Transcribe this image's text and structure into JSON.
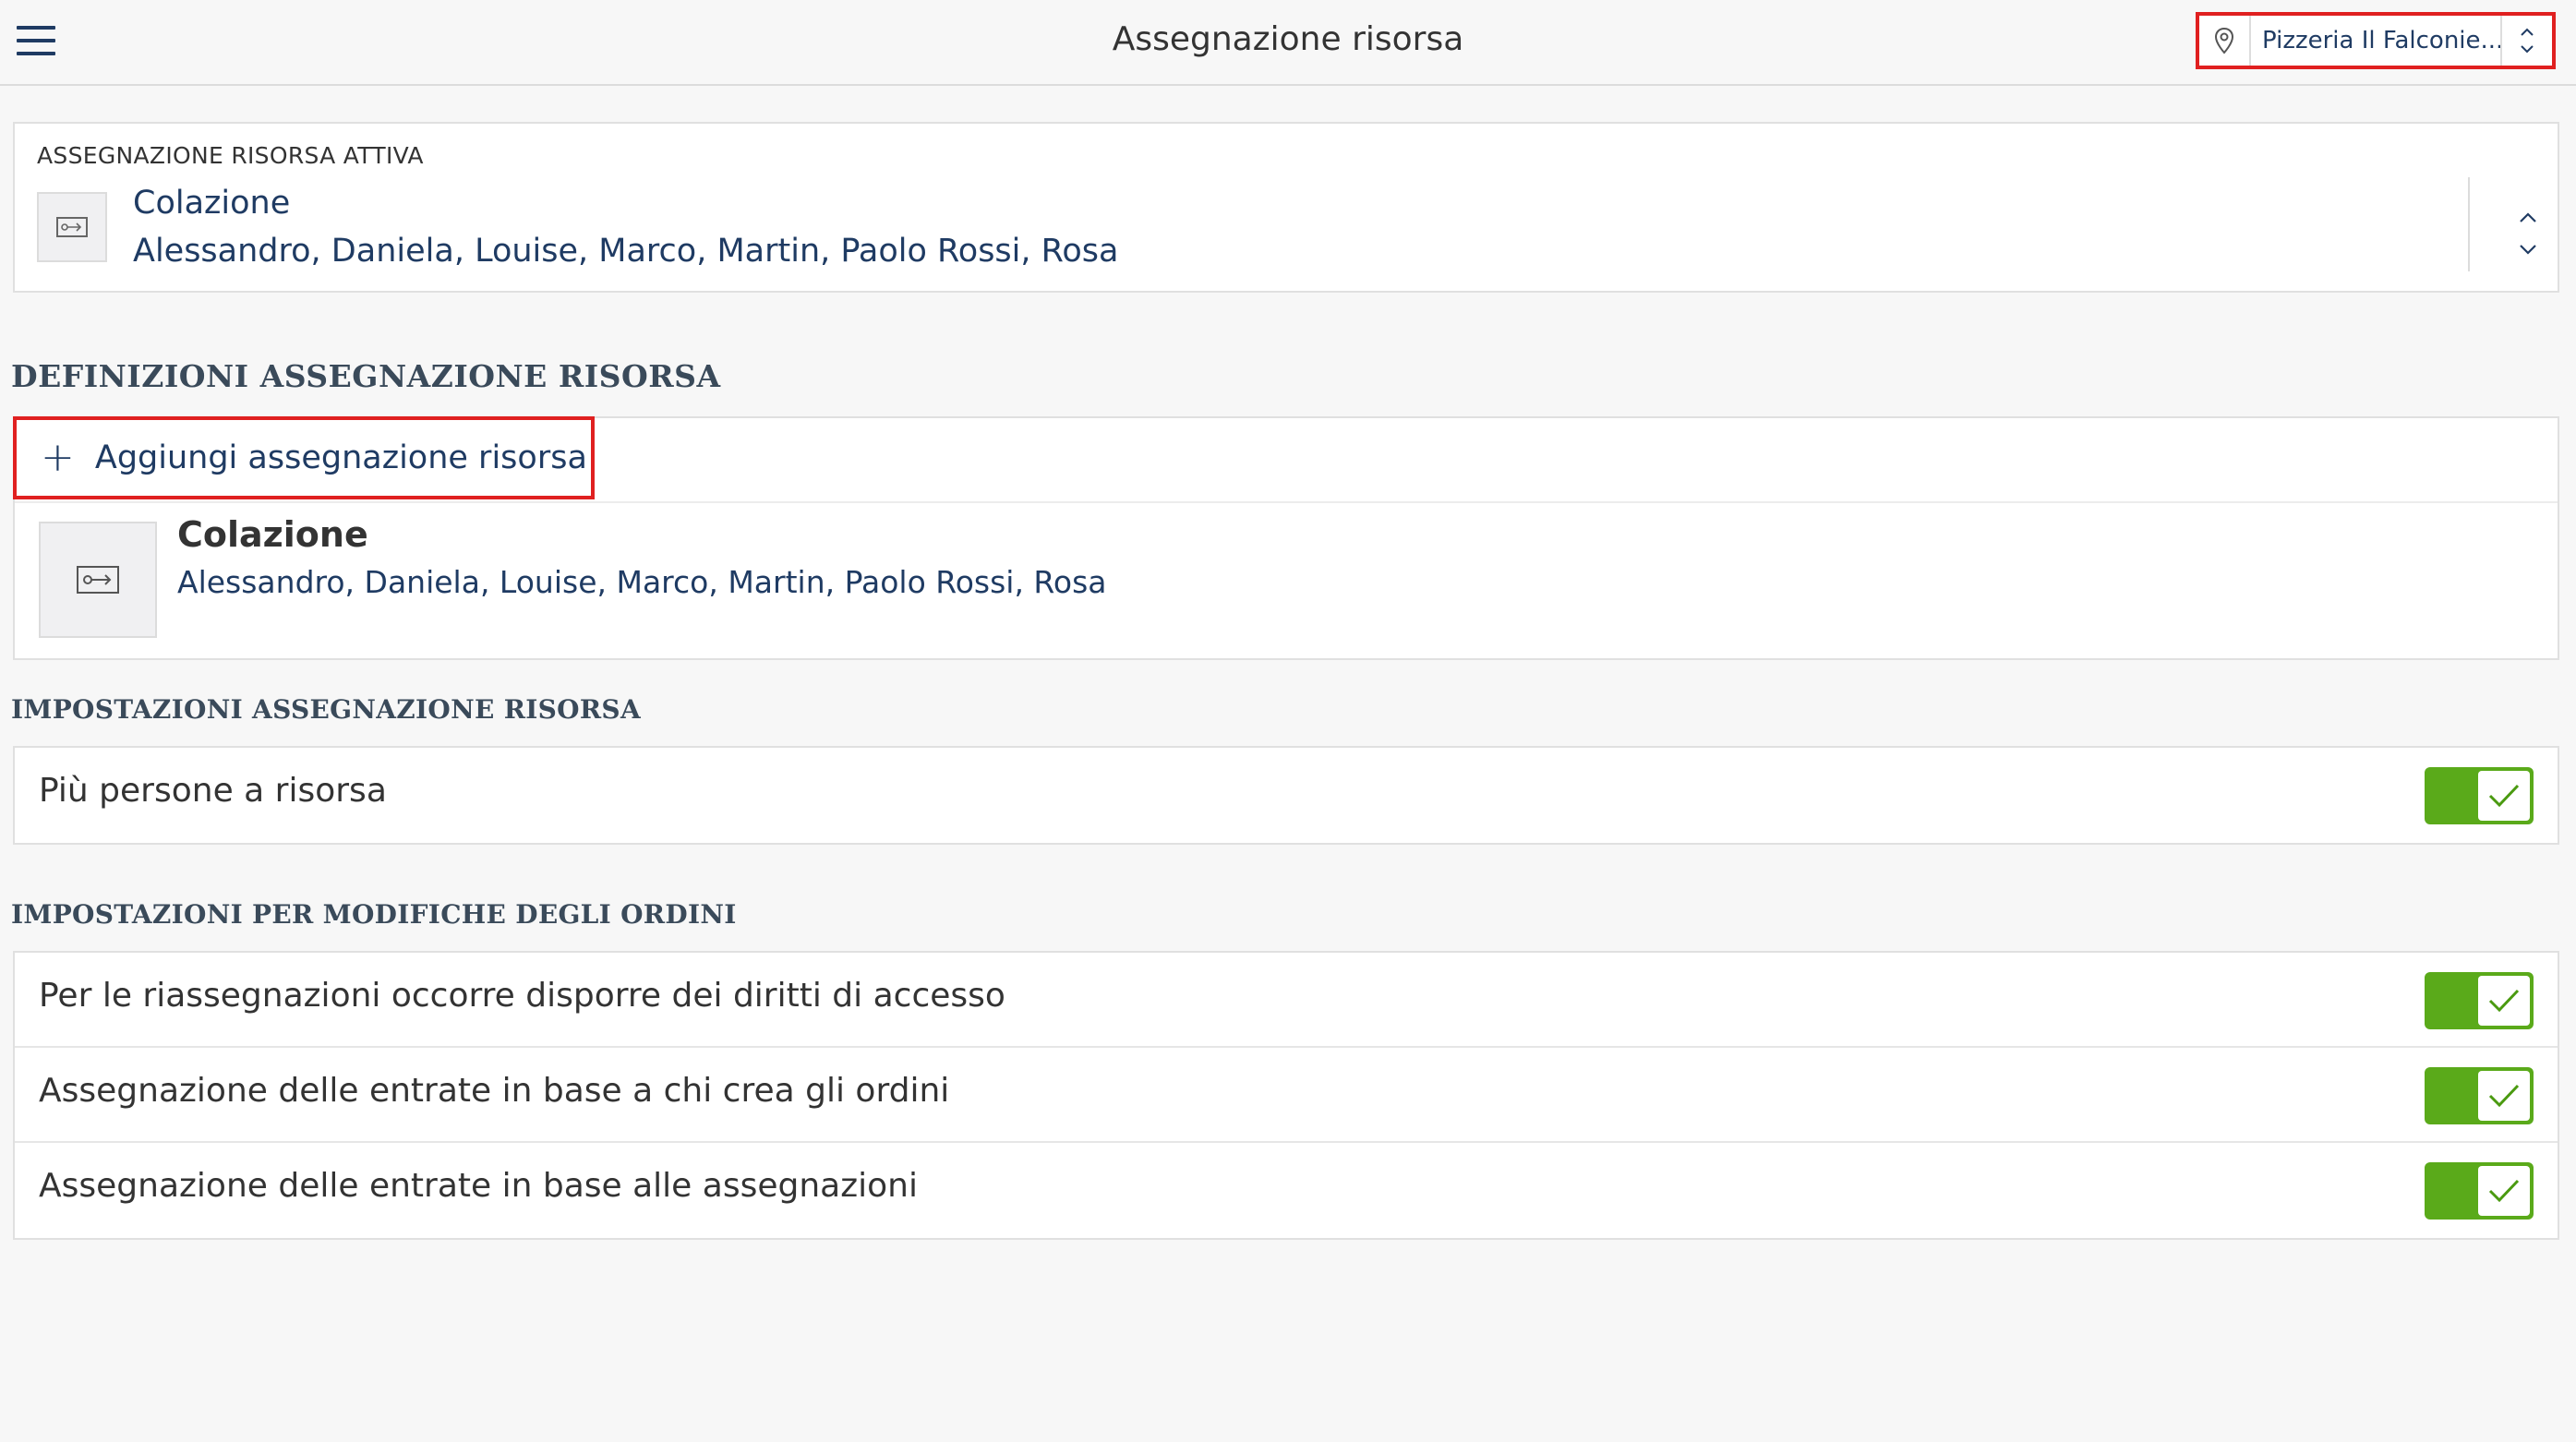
{
  "header": {
    "title": "Assegnazione risorsa",
    "location": "Pizzeria Il Falconie..."
  },
  "active": {
    "caption": "ASSEGNAZIONE RISORSA ATTIVA",
    "name": "Colazione",
    "members": "Alessandro, Daniela, Louise, Marco, Martin, Paolo Rossi, Rosa"
  },
  "definitions": {
    "heading": "DEFINIZIONI ASSEGNAZIONE RISORSA",
    "add_label": "Aggiungi assegnazione risorsa",
    "items": [
      {
        "name": "Colazione",
        "members": "Alessandro, Daniela, Louise, Marco, Martin, Paolo Rossi, Rosa"
      }
    ]
  },
  "resource_settings": {
    "heading": "IMPOSTAZIONI ASSEGNAZIONE RISORSA",
    "rows": [
      {
        "label": "Più persone a risorsa",
        "enabled": true
      }
    ]
  },
  "order_settings": {
    "heading": "IMPOSTAZIONI PER MODIFICHE DEGLI ORDINI",
    "rows": [
      {
        "label": "Per le riassegnazioni occorre disporre dei diritti di accesso",
        "enabled": true
      },
      {
        "label": "Assegnazione delle entrate in base a chi crea gli ordini",
        "enabled": true
      },
      {
        "label": "Assegnazione delle entrate in base alle assegnazioni",
        "enabled": true
      }
    ]
  },
  "colors": {
    "accent": "#1f3b63",
    "toggle_on": "#5aaa1a",
    "highlight": "#e02020"
  }
}
